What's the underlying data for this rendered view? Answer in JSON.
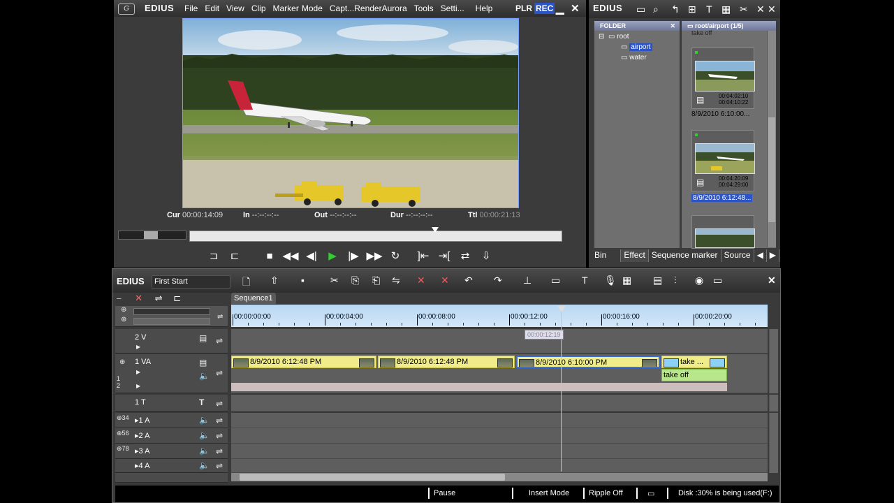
{
  "player": {
    "brand": "EDIUS",
    "menu": [
      "File",
      "Edit",
      "View",
      "Clip",
      "Marker",
      "Mode",
      "Capt...",
      "Render",
      "Aurora",
      "Tools",
      "Setti...",
      "Help"
    ],
    "plr": "PLR",
    "rec": "REC",
    "timecodes": {
      "cur_label": "Cur",
      "cur_value": "00:00:14:09",
      "in_label": "In",
      "in_value": "--:--:--:--",
      "out_label": "Out",
      "out_value": "--:--:--:--",
      "dur_label": "Dur",
      "dur_value": "--:--:--:--",
      "ttl_label": "Ttl",
      "ttl_value": "00:00:21:13"
    },
    "seek_position": 0.66
  },
  "bin": {
    "brand": "EDIUS",
    "folder_header": "FOLDER",
    "clip_header": "root/airport (1/5)",
    "tree": [
      {
        "label": "root",
        "level": 0
      },
      {
        "label": "airport",
        "level": 1,
        "selected": true
      },
      {
        "label": "water",
        "level": 1
      }
    ],
    "partial_label": "take off",
    "clips": [
      {
        "tc_in": "00:04:02:10",
        "tc_out": "00:04:10:22",
        "label": "8/9/2010 6:10:00...",
        "selected": false
      },
      {
        "tc_in": "00:04:20:09",
        "tc_out": "00:04:29:00",
        "label": "8/9/2010 6:12:48...",
        "selected": true
      }
    ],
    "tabs": [
      "Bin",
      "Effect",
      "Sequence marker",
      "Source"
    ]
  },
  "timeline": {
    "brand": "EDIUS",
    "project_name": "First Start",
    "sequence_tab": "Sequence1",
    "ruler_labels": [
      "00:00:00:00",
      "00:00:04:00",
      "00:00:08:00",
      "00:00:12:00",
      "00:00:16:00",
      "00:00:20:00"
    ],
    "hover_tc": "00:00:12:19",
    "tracks": {
      "t2v": "2 V",
      "t1va": "1 VA",
      "t1t": "1 T",
      "a1": "1 A",
      "a2": "2 A",
      "a3": "3 A",
      "a4": "4 A",
      "sub1": "1",
      "sub2": "2",
      "sub3": "3",
      "sub4": "4",
      "sub5": "5",
      "sub6": "6",
      "sub7": "7",
      "sub8": "8"
    },
    "clips": [
      {
        "label": "8/9/2010 6:12:48 PM"
      },
      {
        "label": "8/9/2010 6:12:48 PM"
      },
      {
        "label": "8/9/2010 6:10:00 PM"
      },
      {
        "label": "take ..."
      }
    ],
    "audio_clip_label": "take off",
    "status": {
      "pause": "Pause",
      "insert": "Insert Mode",
      "ripple": "Ripple Off",
      "disk": "Disk :30% is being used(F:)"
    }
  }
}
